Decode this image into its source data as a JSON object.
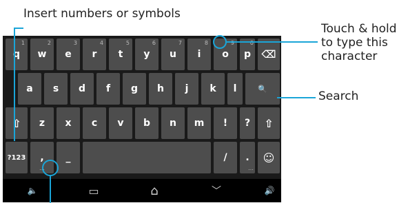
{
  "callouts": {
    "numbers": "Insert numbers or symbols",
    "touch_hold": [
      "Touch & hold",
      "to type this",
      "character"
    ],
    "search": "Search"
  },
  "keyboard": {
    "row1": [
      {
        "label": "q",
        "hint": "1"
      },
      {
        "label": "w",
        "hint": "2"
      },
      {
        "label": "e",
        "hint": "3"
      },
      {
        "label": "r",
        "hint": "4"
      },
      {
        "label": "t",
        "hint": "5"
      },
      {
        "label": "y",
        "hint": "6"
      },
      {
        "label": "u",
        "hint": "7"
      },
      {
        "label": "i",
        "hint": "8"
      },
      {
        "label": "o",
        "hint": "9"
      },
      {
        "label": "p",
        "hint": "0"
      }
    ],
    "row2": [
      "a",
      "s",
      "d",
      "f",
      "g",
      "h",
      "j",
      "k",
      "l"
    ],
    "row3": [
      "z",
      "x",
      "c",
      "v",
      "b",
      "n",
      "m",
      "!",
      "?"
    ],
    "symbols_key": "?123",
    "comma": ",",
    "dash": "_",
    "slash": "/",
    "period": ".",
    "smiley": "☺",
    "search_glyph": "🔍",
    "delete_glyph": "⌫",
    "shift_glyph": "⇧"
  },
  "nav": {
    "volume_down": "🔈",
    "back": "﹀",
    "home": "⌂",
    "recents": "▭",
    "volume_up": "🔊"
  },
  "colors": {
    "accent": "#1aa5d8",
    "key": "#4d4d4d",
    "keyboard_bg": "#1a1a1a"
  }
}
